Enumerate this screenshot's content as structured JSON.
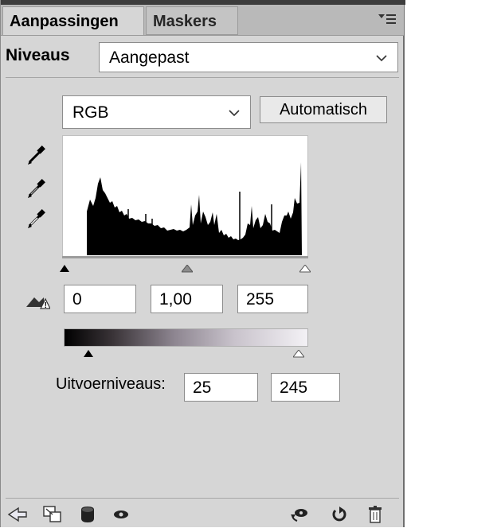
{
  "tabs": [
    {
      "label": "Aanpassingen",
      "active": true
    },
    {
      "label": "Maskers",
      "active": false
    }
  ],
  "adjustment": {
    "title": "Niveaus",
    "preset_value": "Aangepast",
    "channel_value": "RGB",
    "auto_label": "Automatisch"
  },
  "input_levels": {
    "black": "0",
    "gamma": "1,00",
    "white": "255"
  },
  "output_levels": {
    "label": "Uitvoerniveaus:",
    "black": "25",
    "white": "245"
  },
  "icons": {
    "panel_menu": "panel-menu-icon",
    "eyedroppers": [
      "black-point-eyedropper-icon",
      "gray-point-eyedropper-icon",
      "white-point-eyedropper-icon"
    ],
    "clipping_warning": "clipping-warning-icon",
    "bottom_left": [
      "back-arrow-icon",
      "expand-view-icon",
      "clip-to-layer-icon",
      "visibility-eye-icon"
    ],
    "bottom_right": [
      "view-previous-state-icon",
      "reset-icon",
      "delete-icon"
    ]
  }
}
